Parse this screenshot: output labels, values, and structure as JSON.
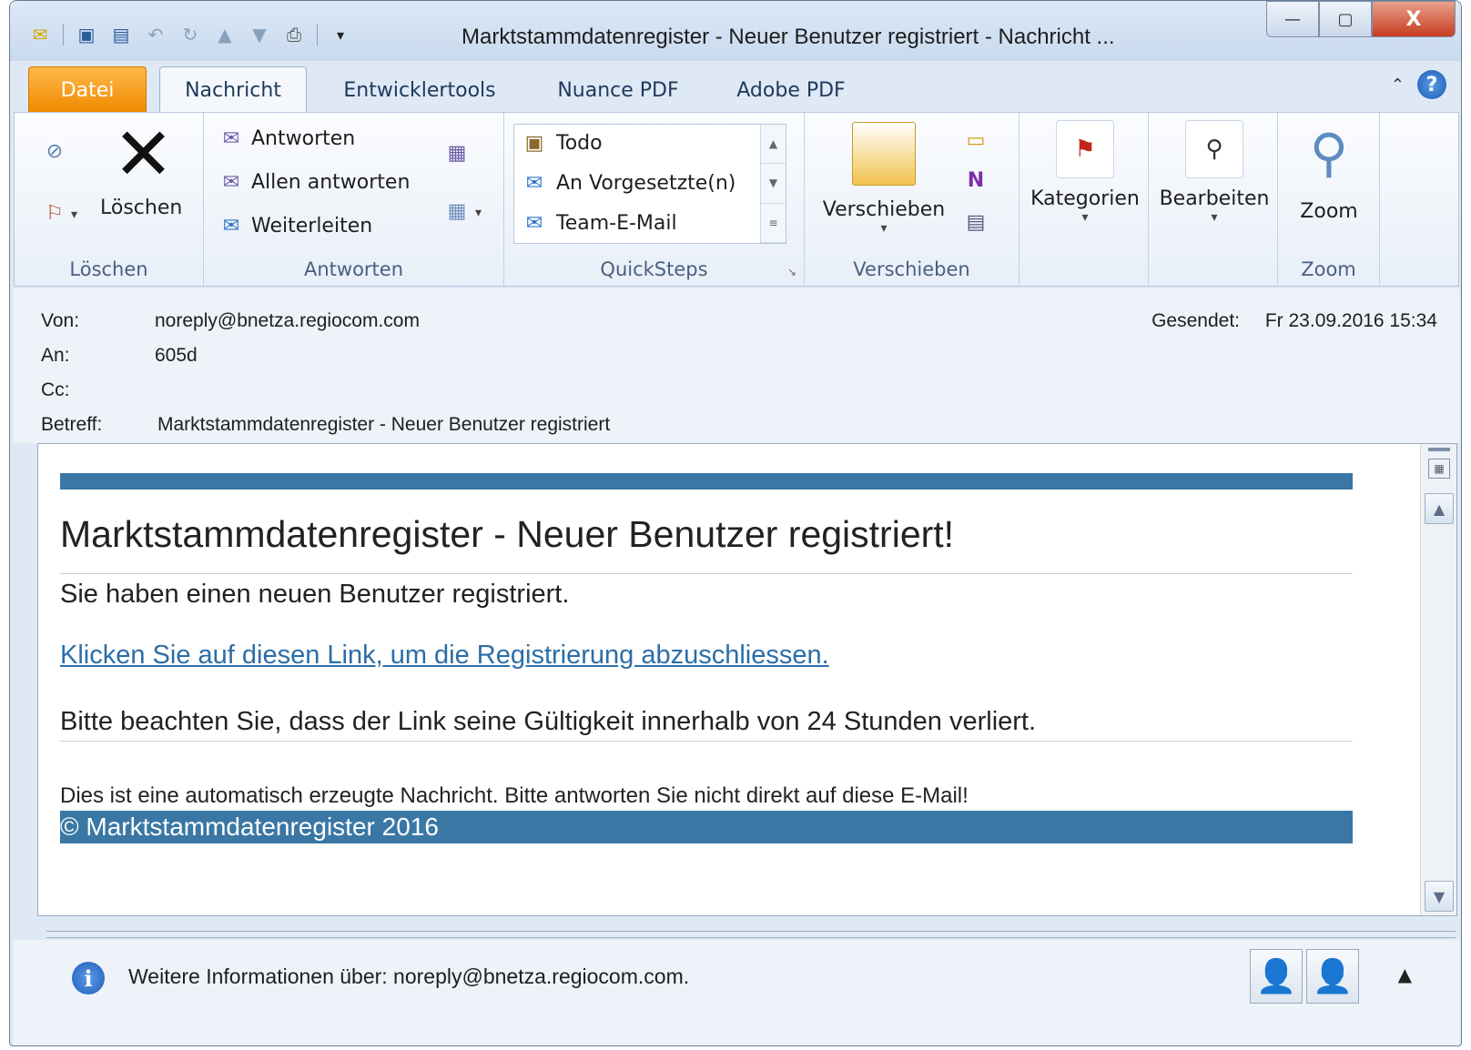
{
  "window": {
    "title": "Marktstammdatenregister - Neuer Benutzer registriert  -  Nachricht ...",
    "buttons": {
      "minimize": "—",
      "maximize": "▢",
      "close": "X"
    }
  },
  "qat": {
    "separator_glyph": "▾"
  },
  "tabs": {
    "datei": "Datei",
    "nachricht": "Nachricht",
    "entwickler": "Entwicklertools",
    "nuance": "Nuance PDF",
    "adobe": "Adobe PDF"
  },
  "ribbon": {
    "loeschen_group": {
      "label": "Löschen",
      "delete_button": "Löschen"
    },
    "antworten_group": {
      "label": "Antworten",
      "reply": "Antworten",
      "reply_all": "Allen antworten",
      "forward": "Weiterleiten"
    },
    "quicksteps_group": {
      "label": "QuickSteps",
      "items": [
        "Todo",
        "An Vorgesetzte(n)",
        "Team-E-Mail"
      ]
    },
    "verschieben_group": {
      "label": "Verschieben",
      "move_button": "Verschieben"
    },
    "tags": {
      "kategorien": "Kategorien",
      "bearbeiten": "Bearbeiten"
    },
    "zoom_group": {
      "label": "Zoom",
      "zoom_button": "Zoom"
    }
  },
  "header": {
    "from_label": "Von:",
    "from": "noreply@bnetza.regiocom.com",
    "to_label": "An:",
    "to": "605d",
    "cc_label": "Cc:",
    "cc": "",
    "subject_label": "Betreff:",
    "subject": "Marktstammdatenregister - Neuer Benutzer registriert",
    "sent_label": "Gesendet:",
    "sent": "Fr 23.09.2016 15:34"
  },
  "body": {
    "title": "Marktstammdatenregister - Neuer Benutzer registriert!",
    "intro": "Sie haben einen neuen Benutzer registriert.",
    "link": "Klicken Sie auf diesen Link, um die Registrierung abzuschliessen.",
    "validity": "Bitte beachten Sie, dass der Link seine Gültigkeit innerhalb von 24 Stunden verliert.",
    "auto_note": "Dies ist eine automatisch erzeugte Nachricht. Bitte antworten Sie nicht direkt auf diese E-Mail!",
    "copyright": "© Marktstammdatenregister 2016",
    "accent_color": "#3a77a4"
  },
  "people_pane": {
    "info": "Weitere Informationen über: noreply@bnetza.regiocom.com."
  }
}
